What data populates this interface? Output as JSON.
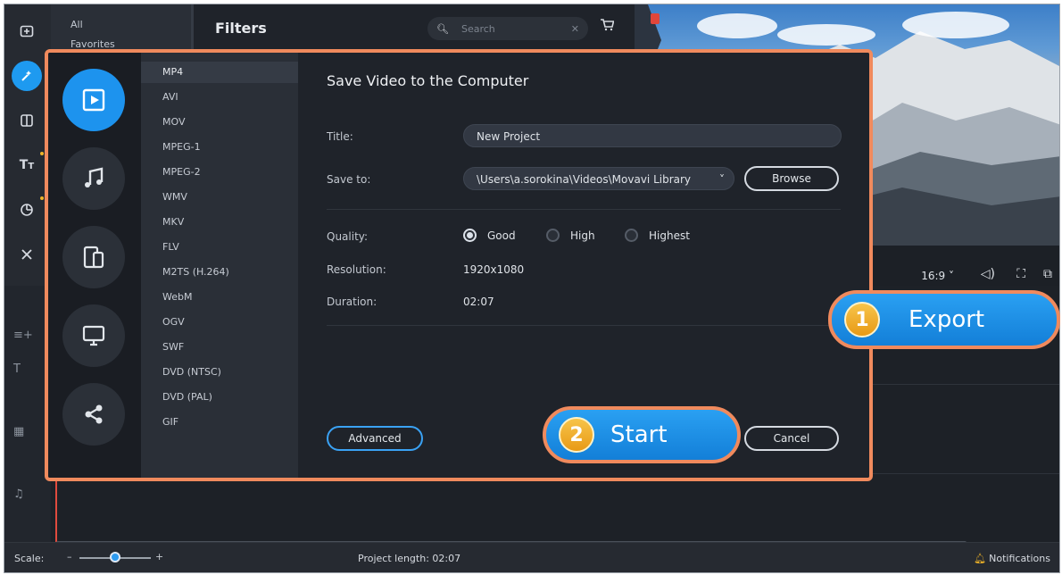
{
  "categories": {
    "all": "All",
    "favorites": "Favorites"
  },
  "filters": {
    "title": "Filters",
    "search_placeholder": "Search"
  },
  "player": {
    "aspect_ratio": "16:9 ˅"
  },
  "dialog": {
    "title": "Save Video to the Computer",
    "formats": [
      "MP4",
      "AVI",
      "MOV",
      "MPEG-1",
      "MPEG-2",
      "WMV",
      "MKV",
      "FLV",
      "M2TS (H.264)",
      "WebM",
      "OGV",
      "SWF",
      "DVD (NTSC)",
      "DVD (PAL)",
      "GIF"
    ],
    "selected_format": "MP4",
    "title_label": "Title:",
    "title_value": "New Project",
    "save_to_label": "Save to:",
    "save_to_value": "\\Users\\a.sorokina\\Videos\\Movavi Library",
    "browse_label": "Browse",
    "quality_label": "Quality:",
    "quality_options": [
      "Good",
      "High",
      "Highest"
    ],
    "quality_selected": "Good",
    "resolution_label": "Resolution:",
    "resolution_value": "1920x1080",
    "duration_label": "Duration:",
    "duration_value": "02:07",
    "advanced_label": "Advanced",
    "cancel_label": "Cancel"
  },
  "callouts": {
    "export": {
      "number": "1",
      "label": "Export"
    },
    "start": {
      "number": "2",
      "label": "Start"
    }
  },
  "status": {
    "scale_label": "Scale:",
    "project_length": "Project length: 02:07",
    "notifications": "Notifications"
  },
  "colors": {
    "accent": "#1d93ee",
    "highlight": "#f08a5d",
    "badge": "#f0b428"
  }
}
